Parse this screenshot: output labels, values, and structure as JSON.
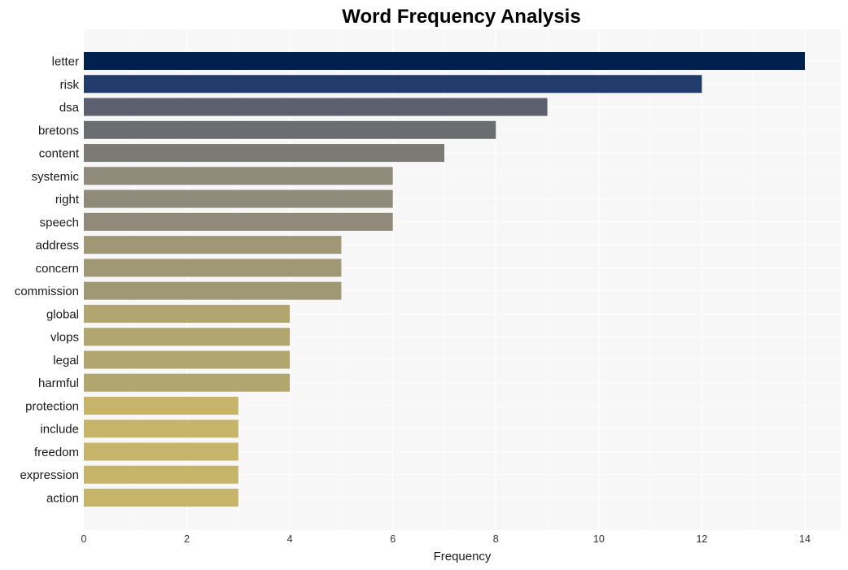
{
  "chart_data": {
    "type": "bar",
    "orientation": "horizontal",
    "title": "Word Frequency Analysis",
    "xlabel": "Frequency",
    "ylabel": "",
    "xlim": [
      0,
      14.7
    ],
    "xticks": [
      0,
      2,
      4,
      6,
      8,
      10,
      12,
      14
    ],
    "grid": true,
    "legend": "none",
    "categories": [
      "letter",
      "risk",
      "dsa",
      "bretons",
      "content",
      "systemic",
      "right",
      "speech",
      "address",
      "concern",
      "commission",
      "global",
      "vlops",
      "legal",
      "harmful",
      "protection",
      "include",
      "freedom",
      "expression",
      "action"
    ],
    "values": [
      14,
      12,
      9,
      8,
      7,
      6,
      6,
      6,
      5,
      5,
      5,
      4,
      4,
      4,
      4,
      3,
      3,
      3,
      3,
      3
    ],
    "colors": [
      "#00204d",
      "#213b6b",
      "#5c5f6e",
      "#6c6d71",
      "#7c7a75",
      "#8f8a79",
      "#8f8a79",
      "#8f8a79",
      "#a09775",
      "#a09775",
      "#a09775",
      "#b1a66f",
      "#b1a66f",
      "#b1a66f",
      "#b1a66f",
      "#c5b46a",
      "#c5b46a",
      "#c5b46a",
      "#c5b46a",
      "#c5b46a"
    ]
  },
  "style": {
    "plot_background": "#f7f7f7",
    "grid_color": "#ffffff"
  }
}
